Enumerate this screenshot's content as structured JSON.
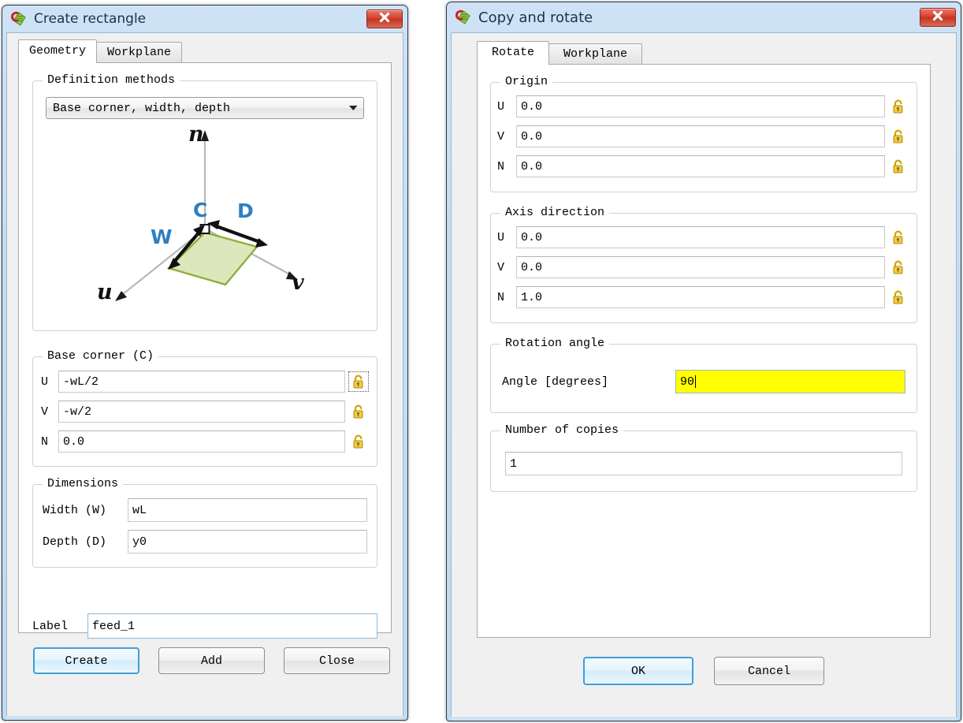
{
  "app": {
    "icon": "comsol-icon"
  },
  "dialogs": [
    {
      "id": "create-rectangle",
      "title": "Create rectangle",
      "close_label": "x",
      "tabs": [
        {
          "label": "Geometry",
          "active": true
        },
        {
          "label": "Workplane",
          "active": false
        }
      ],
      "groups": {
        "definition_methods": {
          "legend": "Definition methods",
          "combo_value": "Base corner, width, depth",
          "arrow": "chevron-down-icon",
          "diagram": {
            "axis_n": "n",
            "axis_u": "u",
            "axis_v": "v",
            "point_c": "C",
            "arrow_w": "W",
            "arrow_d": "D",
            "face_color": "#dbe7b8",
            "face_border": "#8aab3c",
            "label_color": "#2f7fc1"
          }
        },
        "base_corner": {
          "legend": "Base corner (C)",
          "rows": [
            {
              "label": "U",
              "value": "-wL/2",
              "lock": "unlocked-padlock-icon",
              "lock_focused": true
            },
            {
              "label": "V",
              "value": "-w/2",
              "lock": "unlocked-padlock-icon",
              "lock_focused": false
            },
            {
              "label": "N",
              "value": "0.0",
              "lock": "unlocked-padlock-icon",
              "lock_focused": false
            }
          ]
        },
        "dimensions": {
          "legend": "Dimensions",
          "rows": [
            {
              "label": "Width (W)",
              "value": "wL"
            },
            {
              "label": "Depth (D)",
              "value": "y0"
            }
          ]
        }
      },
      "label_field": {
        "label": "Label",
        "value": "feed_1"
      },
      "buttons": [
        {
          "label": "Create",
          "default": true
        },
        {
          "label": "Add",
          "default": false
        },
        {
          "label": "Close",
          "default": false
        }
      ]
    },
    {
      "id": "copy-and-rotate",
      "title": "Copy and rotate",
      "close_label": "x",
      "tabs": [
        {
          "label": "Rotate",
          "active": true
        },
        {
          "label": "Workplane",
          "active": false
        }
      ],
      "groups": {
        "origin": {
          "legend": "Origin",
          "rows": [
            {
              "label": "U",
              "value": "0.0",
              "lock": "unlocked-padlock-icon"
            },
            {
              "label": "V",
              "value": "0.0",
              "lock": "unlocked-padlock-icon"
            },
            {
              "label": "N",
              "value": "0.0",
              "lock": "unlocked-padlock-icon"
            }
          ]
        },
        "axis_direction": {
          "legend": "Axis direction",
          "rows": [
            {
              "label": "U",
              "value": "0.0",
              "lock": "unlocked-padlock-icon"
            },
            {
              "label": "V",
              "value": "0.0",
              "lock": "unlocked-padlock-icon"
            },
            {
              "label": "N",
              "value": "1.0",
              "lock": "unlocked-padlock-icon"
            }
          ]
        },
        "rotation_angle": {
          "legend": "Rotation angle",
          "field_label": "Angle [degrees]",
          "field_value": "90",
          "field_editing": true,
          "field_bg": "#ffff00"
        },
        "number_of_copies": {
          "legend": "Number of copies",
          "value": "1"
        }
      },
      "buttons": [
        {
          "label": "OK",
          "default": true
        },
        {
          "label": "Cancel",
          "default": false
        }
      ]
    }
  ],
  "colors": {
    "titlebar_gradient_top": "#cfe2f5",
    "close_red": "#d6422f",
    "default_button_border": "#3d9fd8",
    "edit_highlight": "#ffff00",
    "lock_gold": "#e8c33a"
  }
}
